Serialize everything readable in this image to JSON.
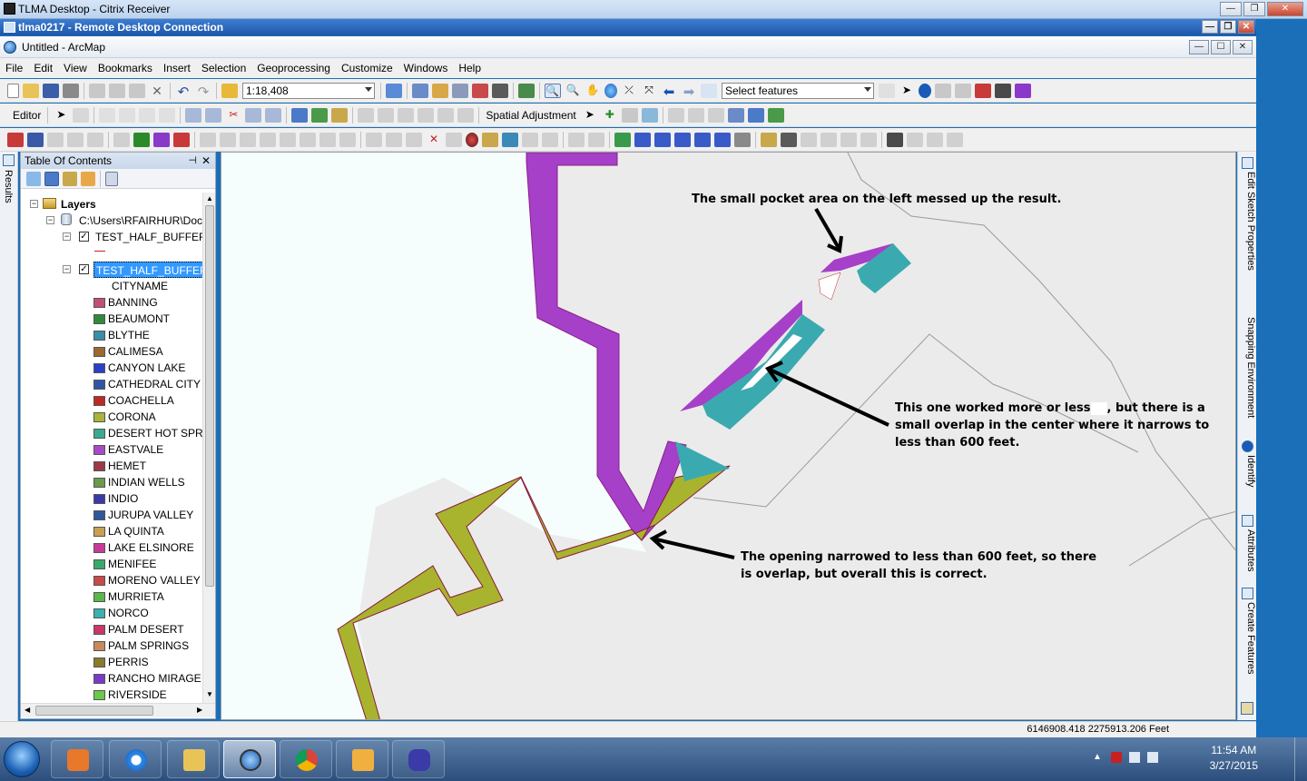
{
  "citrix": {
    "title": "TLMA Desktop - Citrix Receiver"
  },
  "rdc": {
    "title": "tlma0217 - Remote Desktop Connection"
  },
  "arcmap": {
    "title": "Untitled - ArcMap"
  },
  "menu": [
    "File",
    "Edit",
    "View",
    "Bookmarks",
    "Insert",
    "Selection",
    "Geoprocessing",
    "Customize",
    "Windows",
    "Help"
  ],
  "toolbar": {
    "scale": "1:18,408",
    "select_features": "Select features",
    "editor": "Editor",
    "spatial_adjustment": "Spatial Adjustment"
  },
  "results_tab": "Results",
  "toc": {
    "title": "Table Of Contents",
    "layers_label": "Layers",
    "folder": "C:\\Users\\RFAIRHUR\\Doc",
    "layer1": "TEST_HALF_BUFFERS",
    "layer2": "TEST_HALF_BUFFERS",
    "field": "CITYNAME",
    "cities": [
      {
        "name": "BANNING",
        "color": "#c0507a"
      },
      {
        "name": "BEAUMONT",
        "color": "#2e8b3e"
      },
      {
        "name": "BLYTHE",
        "color": "#3a8fa8"
      },
      {
        "name": "CALIMESA",
        "color": "#9a6a2e"
      },
      {
        "name": "CANYON LAKE",
        "color": "#2c3fc8"
      },
      {
        "name": "CATHEDRAL CITY",
        "color": "#2f55a8"
      },
      {
        "name": "COACHELLA",
        "color": "#c02828"
      },
      {
        "name": "CORONA",
        "color": "#a8b43a"
      },
      {
        "name": "DESERT HOT SPRIN",
        "color": "#3aaa8e"
      },
      {
        "name": "EASTVALE",
        "color": "#a84ac8"
      },
      {
        "name": "HEMET",
        "color": "#9a3a4a"
      },
      {
        "name": "INDIAN WELLS",
        "color": "#6a9a4a"
      },
      {
        "name": "INDIO",
        "color": "#3a3aa8"
      },
      {
        "name": "JURUPA VALLEY",
        "color": "#2e5a9a"
      },
      {
        "name": "LA QUINTA",
        "color": "#c8a050"
      },
      {
        "name": "LAKE ELSINORE",
        "color": "#c83a9a"
      },
      {
        "name": "MENIFEE",
        "color": "#3aa86a"
      },
      {
        "name": "MORENO VALLEY",
        "color": "#c84a4a"
      },
      {
        "name": "MURRIETA",
        "color": "#5ab84a"
      },
      {
        "name": "NORCO",
        "color": "#3ab0b0"
      },
      {
        "name": "PALM DESERT",
        "color": "#c8386a"
      },
      {
        "name": "PALM SPRINGS",
        "color": "#c88a5a"
      },
      {
        "name": "PERRIS",
        "color": "#8a7a2a"
      },
      {
        "name": "RANCHO MIRAGE",
        "color": "#7a3ac8"
      },
      {
        "name": "RIVERSIDE",
        "color": "#6ac84a"
      }
    ]
  },
  "annotations": {
    "a1": "The small pocket area on the left messed up the result.",
    "a2_l1": "This one worked more or less",
    "a2_l1b": ", but there is a",
    "a2_l2": "small overlap in the center where it narrows to",
    "a2_l3": "less than 600 feet.",
    "a3_l1": "The opening narrowed to less than 600 feet, so there",
    "a3_l2": "is overlap, but overall this is correct."
  },
  "right_dock": [
    "Edit Sketch Properties",
    "Snapping Environment",
    "Identify",
    "Attributes",
    "Create Features"
  ],
  "status": {
    "coords": "6146908.418  2275913.206 Feet"
  },
  "tray": {
    "time": "11:54 AM",
    "date": "3/27/2015"
  },
  "colors": {
    "purple": "#a640c8",
    "olive": "#a8b42e",
    "teal": "#3aaab0",
    "map_bg": "#ebebeb",
    "water": "#f5fdfd"
  }
}
